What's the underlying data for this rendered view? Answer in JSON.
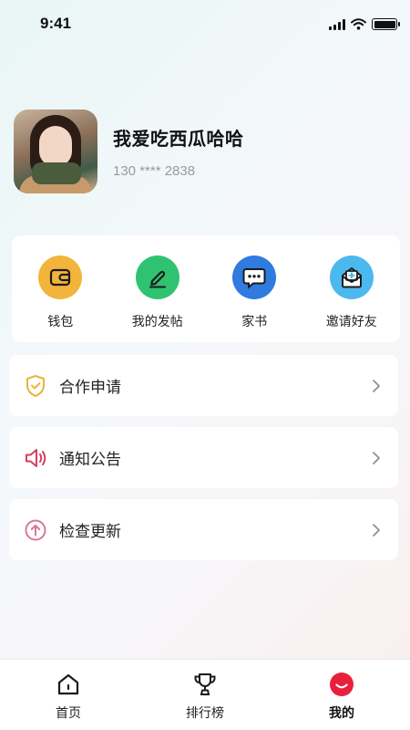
{
  "status_bar": {
    "time": "9:41"
  },
  "profile": {
    "username": "我爱吃西瓜哈哈",
    "phone": "130 **** 2838"
  },
  "quick_actions": [
    {
      "label": "钱包",
      "icon": "wallet-icon",
      "color": "#F2B43A"
    },
    {
      "label": "我的发帖",
      "icon": "pen-icon",
      "color": "#2FC271"
    },
    {
      "label": "家书",
      "icon": "chat-bubble-icon",
      "color": "#2F7BE0"
    },
    {
      "label": "邀请好友",
      "icon": "mail-invite-icon",
      "color": "#4BB8EE"
    }
  ],
  "menu": [
    {
      "label": "合作申请",
      "icon": "shield-check-icon",
      "color": "#E9B437"
    },
    {
      "label": "通知公告",
      "icon": "speaker-icon",
      "color": "#D2415C"
    },
    {
      "label": "检查更新",
      "icon": "arrow-up-circle-icon",
      "color": "#D8789A"
    }
  ],
  "tabbar": {
    "tabs": [
      {
        "label": "首页",
        "icon": "home-icon"
      },
      {
        "label": "排行榜",
        "icon": "trophy-icon"
      },
      {
        "label": "我的",
        "icon": "smile-icon",
        "active": true
      }
    ],
    "active_color": "#E8203C"
  }
}
